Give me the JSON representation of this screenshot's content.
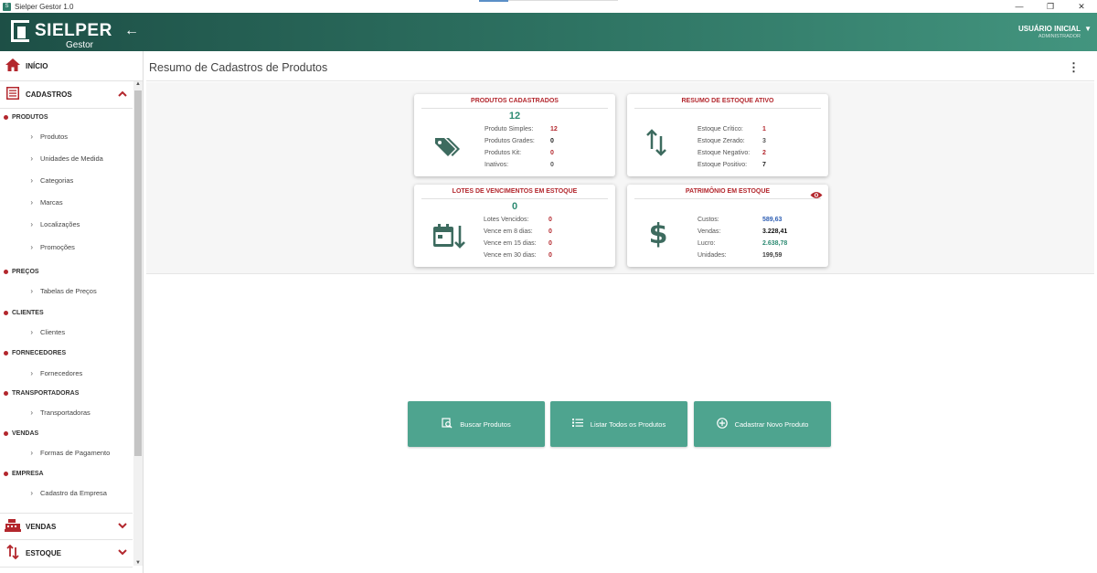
{
  "window": {
    "title": "Sielper Gestor 1.0",
    "icon": "app-icon",
    "controls": [
      "—",
      "❐",
      "✕"
    ]
  },
  "header": {
    "logo_name": "SIELPER",
    "logo_sub": "Gestor",
    "back_icon": "arrow-left-icon",
    "user_name": "USUÁRIO INICIAL",
    "user_role": "ADMINISTRADOR",
    "colors": {
      "start": "#1d4f46",
      "end": "#43957f"
    }
  },
  "sidebar": {
    "home": {
      "label": "INÍCIO",
      "icon": "home-icon"
    },
    "cadastros": {
      "label": "CADASTROS",
      "icon": "list-icon",
      "expanded": true
    },
    "groups": [
      {
        "label": "PRODUTOS",
        "items": [
          "Produtos",
          "Unidades de Medida",
          "Categorias",
          "Marcas",
          "Localizações",
          "Promoções"
        ]
      },
      {
        "label": "PREÇOS",
        "items": [
          "Tabelas de Preços"
        ]
      },
      {
        "label": "CLIENTES",
        "items": [
          "Clientes"
        ]
      },
      {
        "label": "FORNECEDORES",
        "items": [
          "Fornecedores"
        ]
      },
      {
        "label": "TRANSPORTADORAS",
        "items": [
          "Transportadoras"
        ]
      },
      {
        "label": "VENDAS",
        "items": [
          "Formas de Pagamento"
        ]
      },
      {
        "label": "EMPRESA",
        "items": [
          "Cadastro da Empresa"
        ]
      }
    ],
    "vendas": {
      "label": "VENDAS",
      "icon": "cash-register-icon"
    },
    "estoque": {
      "label": "ESTOQUE",
      "icon": "swap-vertical-icon"
    },
    "accent": "#b3272d"
  },
  "main": {
    "title": "Resumo de Cadastros de Produtos",
    "cards": {
      "produtos": {
        "title": "PRODUTOS CADASTRADOS",
        "total": "12",
        "icon": "tags-icon",
        "rows": [
          {
            "label": "Produto Simples:",
            "value": "12"
          },
          {
            "label": "Produtos Grades:",
            "value": "0"
          },
          {
            "label": "Produtos Kit:",
            "value": "0"
          },
          {
            "label": "Inativos:",
            "value": "0"
          }
        ]
      },
      "estoque": {
        "title": "RESUMO DE ESTOQUE ATIVO",
        "icon": "swap-vertical-icon",
        "rows": [
          {
            "label": "Estoque Crítico:",
            "value": "1"
          },
          {
            "label": "Estoque Zerado:",
            "value": "3"
          },
          {
            "label": "Estoque Negativo:",
            "value": "2"
          },
          {
            "label": "Estoque Positivo:",
            "value": "7"
          }
        ]
      },
      "lotes": {
        "title": "LOTES DE VENCIMENTOS EM ESTOQUE",
        "total": "0",
        "icon": "calendar-arrow-down-icon",
        "rows": [
          {
            "label": "Lotes Vencidos:",
            "value": "0"
          },
          {
            "label": "Vence em 8 dias:",
            "value": "0"
          },
          {
            "label": "Vence em 15 dias:",
            "value": "0"
          },
          {
            "label": "Vence em 30 dias:",
            "value": "0"
          }
        ]
      },
      "patrimonio": {
        "title": "PATRIMÔNIO EM ESTOQUE",
        "icon": "dollar-icon",
        "eye_icon": "eye-icon",
        "rows": [
          {
            "label": "Custos:",
            "value": "589,63",
            "color": "#2f5fb3"
          },
          {
            "label": "Vendas:",
            "value": "3.228,41",
            "color": "#111111"
          },
          {
            "label": "Lucro:",
            "value": "2.638,78",
            "color": "#2e8b73"
          },
          {
            "label": "Unidades:",
            "value": "199,59",
            "color": "#444444"
          }
        ]
      }
    },
    "actions": [
      {
        "label": "Buscar Produtos",
        "icon": "search-doc-icon"
      },
      {
        "label": "Listar Todos os Produtos",
        "icon": "list-icon"
      },
      {
        "label": "Cadastrar Novo Produto",
        "icon": "plus-circle-icon"
      }
    ],
    "action_color": "#4ea48f"
  }
}
